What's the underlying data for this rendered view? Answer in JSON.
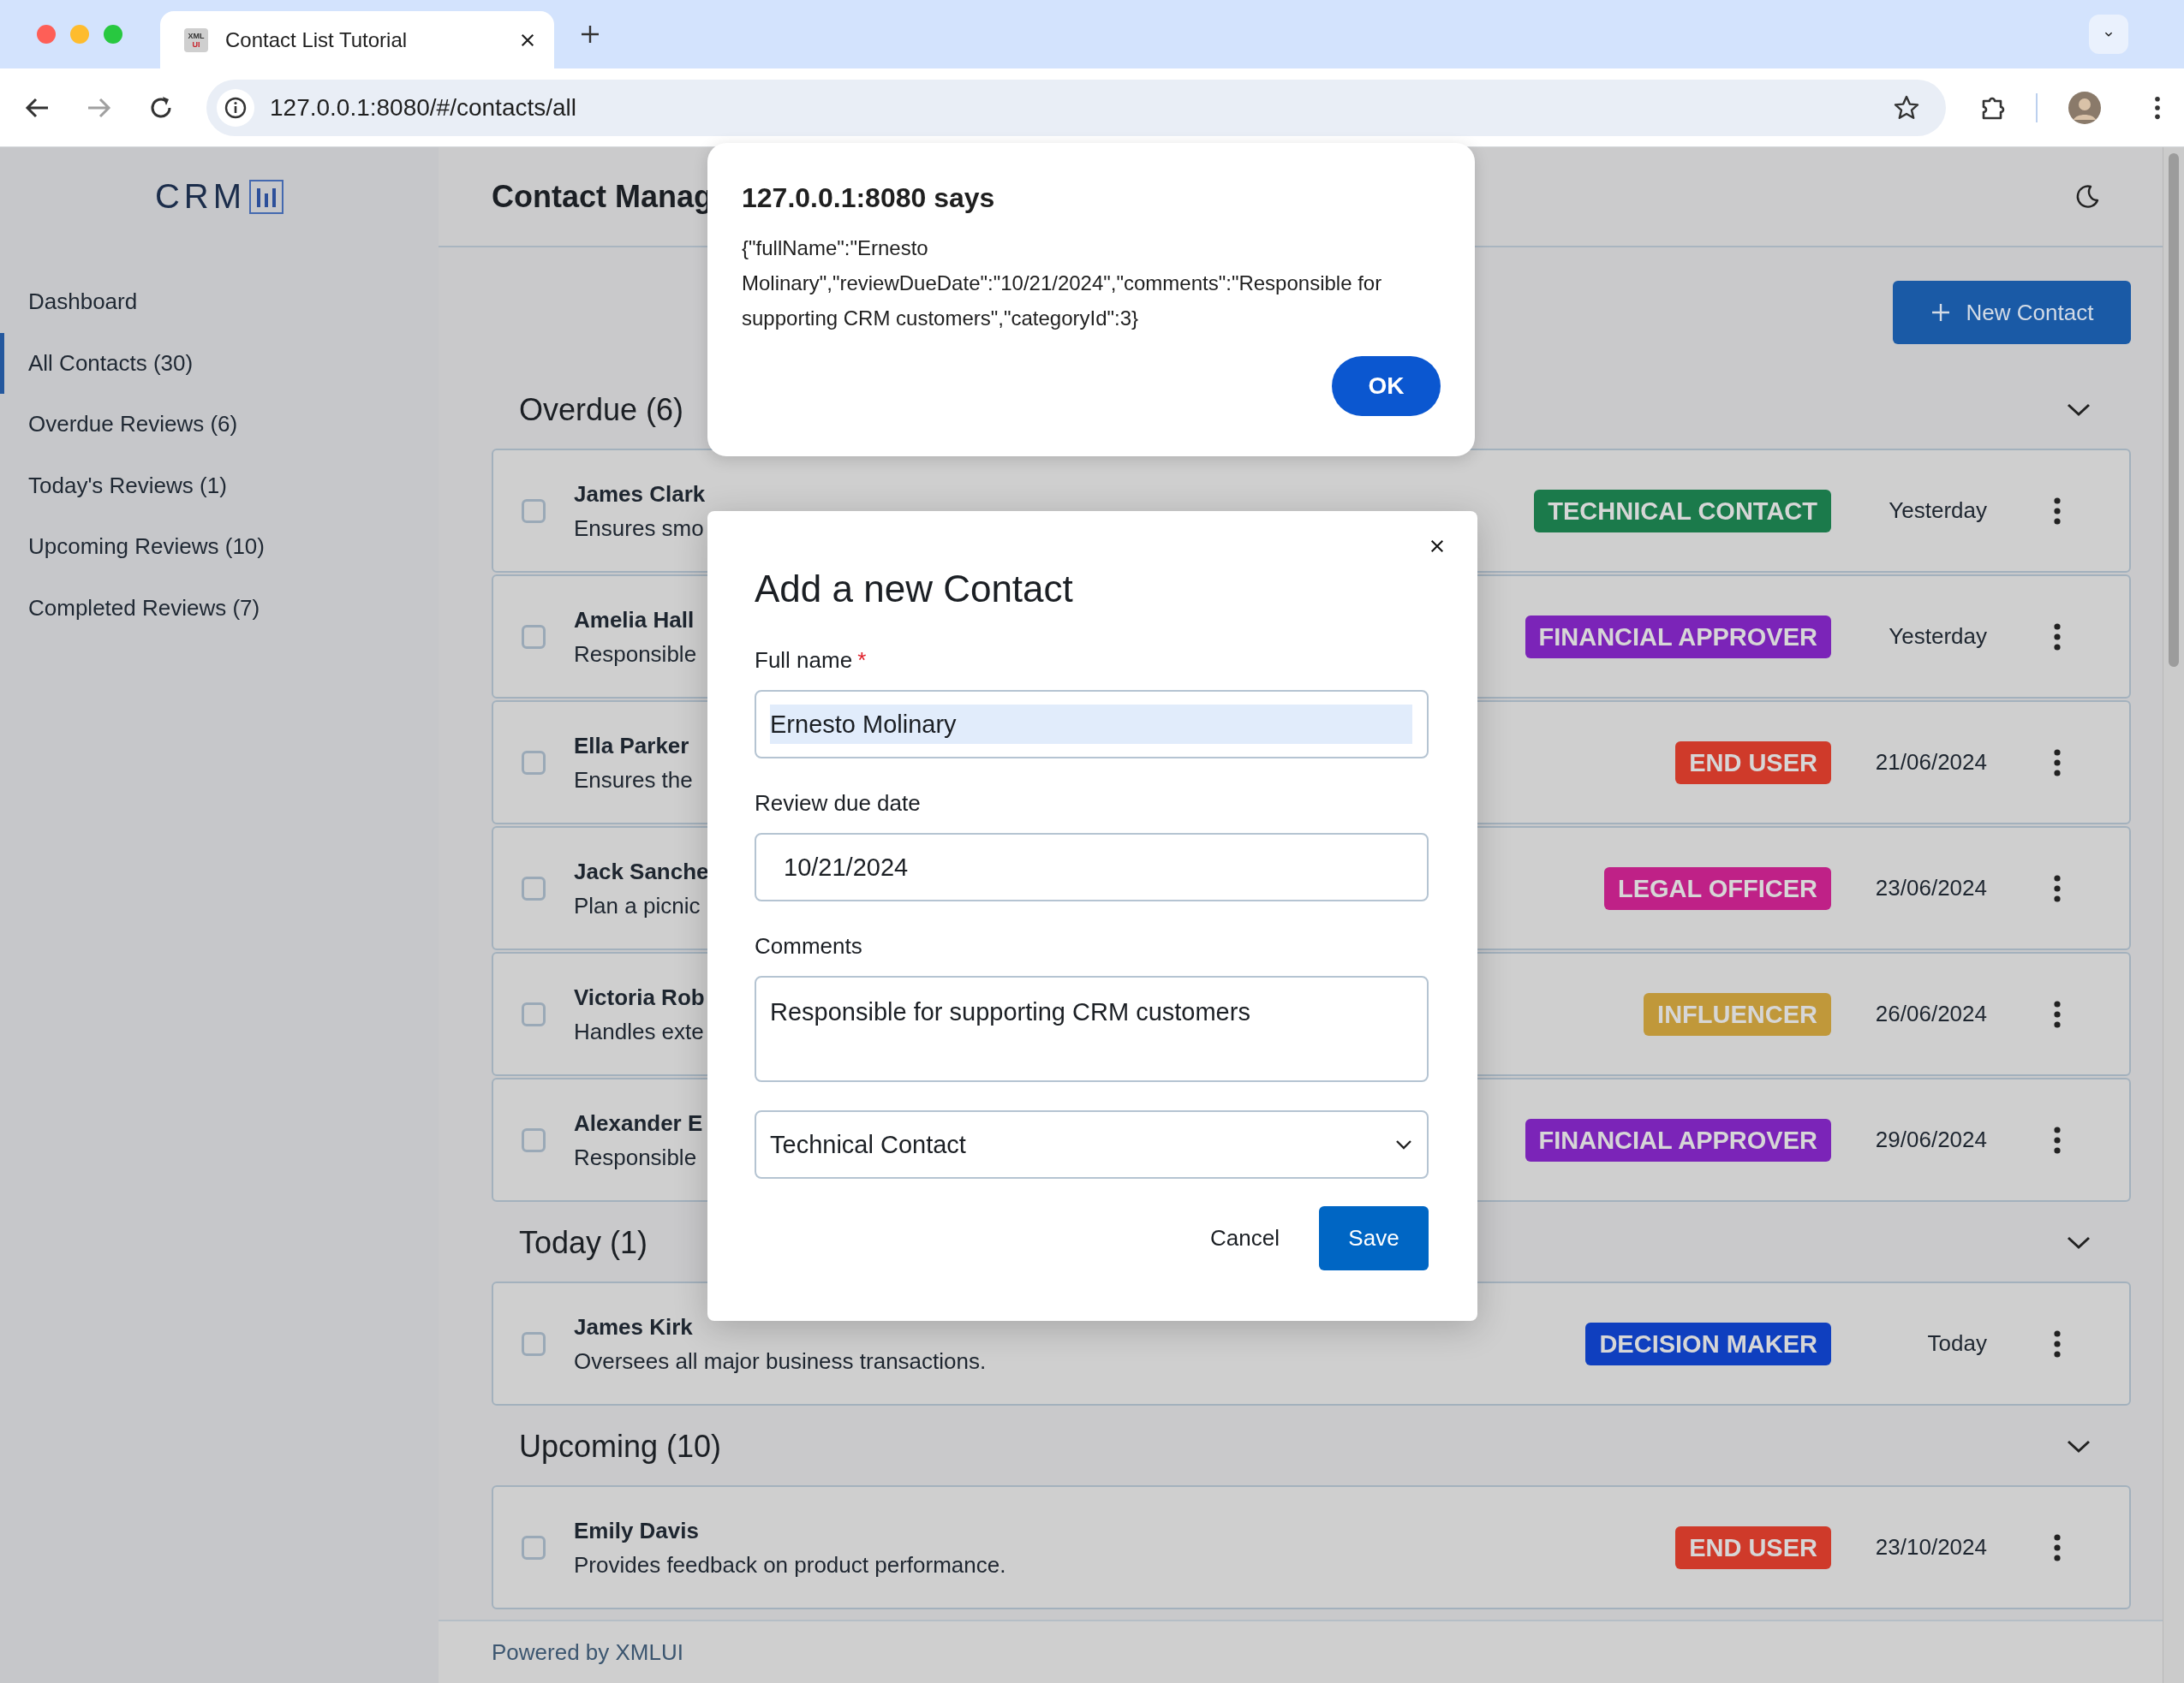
{
  "browser": {
    "tab_title": "Contact List Tutorial",
    "favicon": {
      "line_1": "XML",
      "line_2": "UI"
    },
    "url": "127.0.0.1:8080/#/contacts/all",
    "forward_disabled": true
  },
  "sidebar": {
    "logo": "CRM",
    "items": [
      {
        "label": "Dashboard",
        "selected": false
      },
      {
        "label": "All Contacts (30)",
        "selected": true
      },
      {
        "label": "Overdue Reviews (6)",
        "selected": false
      },
      {
        "label": "Today's Reviews (1)",
        "selected": false
      },
      {
        "label": "Upcoming Reviews (10)",
        "selected": false
      },
      {
        "label": "Completed Reviews (7)",
        "selected": false
      }
    ]
  },
  "header": {
    "title": "Contact Manag"
  },
  "new_contact_button": "New Contact",
  "sections": [
    {
      "title": "Overdue (6)",
      "expanded": true,
      "contacts": [
        {
          "name": "James Clark",
          "description": "Ensures smo",
          "badge": {
            "label": "TECHNICAL CONTACT",
            "color": "#1b7a4b"
          },
          "date": "Yesterday",
          "checked": false
        },
        {
          "name": "Amelia Hall",
          "description": "Responsible",
          "badge": {
            "label": "FINANCIAL APPROVER",
            "color": "#7b24b8"
          },
          "date": "Yesterday",
          "checked": false
        },
        {
          "name": "Ella Parker",
          "description": "Ensures the",
          "badge": {
            "label": "END USER",
            "color": "#cf3a2a"
          },
          "date": "21/06/2024",
          "checked": false
        },
        {
          "name": "Jack Sanche",
          "description": "Plan a picnic",
          "badge": {
            "label": "LEGAL OFFICER",
            "color": "#bf2187"
          },
          "date": "23/06/2024",
          "checked": false
        },
        {
          "name": "Victoria Rob",
          "description": "Handles exte",
          "badge": {
            "label": "INFLUENCER",
            "color": "#c0983a"
          },
          "date": "26/06/2024",
          "checked": false
        },
        {
          "name": "Alexander E",
          "description": "Responsible",
          "badge": {
            "label": "FINANCIAL APPROVER",
            "color": "#7b24b8"
          },
          "date": "29/06/2024",
          "checked": false
        }
      ]
    },
    {
      "title": "Today (1)",
      "expanded": true,
      "contacts": [
        {
          "name": "James Kirk",
          "description": "Oversees all major business transactions.",
          "badge": {
            "label": "DECISION MAKER",
            "color": "#0f3fbf"
          },
          "date": "Today",
          "checked": false
        }
      ]
    },
    {
      "title": "Upcoming (10)",
      "expanded": true,
      "contacts": [
        {
          "name": "Emily Davis",
          "description": "Provides feedback on product performance.",
          "badge": {
            "label": "END USER",
            "color": "#cf3a2a"
          },
          "date": "23/10/2024",
          "checked": false
        }
      ]
    }
  ],
  "footer": "Powered by XMLUI",
  "alert": {
    "title": "127.0.0.1:8080 says",
    "message": "{\"fullName\":\"Ernesto Molinary\",\"reviewDueDate\":\"10/21/2024\",\"comments\":\"Responsible for supporting CRM customers\",\"categoryId\":3}",
    "ok_button": "OK"
  },
  "dialog": {
    "title": "Add a new Contact",
    "fields": [
      {
        "kind": "text",
        "label": "Full name",
        "required_mark": "*",
        "value": "Ernesto Molinary",
        "selected": true
      },
      {
        "kind": "date",
        "label": "Review due date",
        "value": "10/21/2024",
        "selected": false
      },
      {
        "kind": "textarea",
        "label": "Comments",
        "value": "Responsible for supporting CRM customers",
        "selected": false
      },
      {
        "kind": "select",
        "value": "Technical Contact",
        "selected": false
      }
    ],
    "cancel_button": "Cancel",
    "save_button": "Save"
  }
}
